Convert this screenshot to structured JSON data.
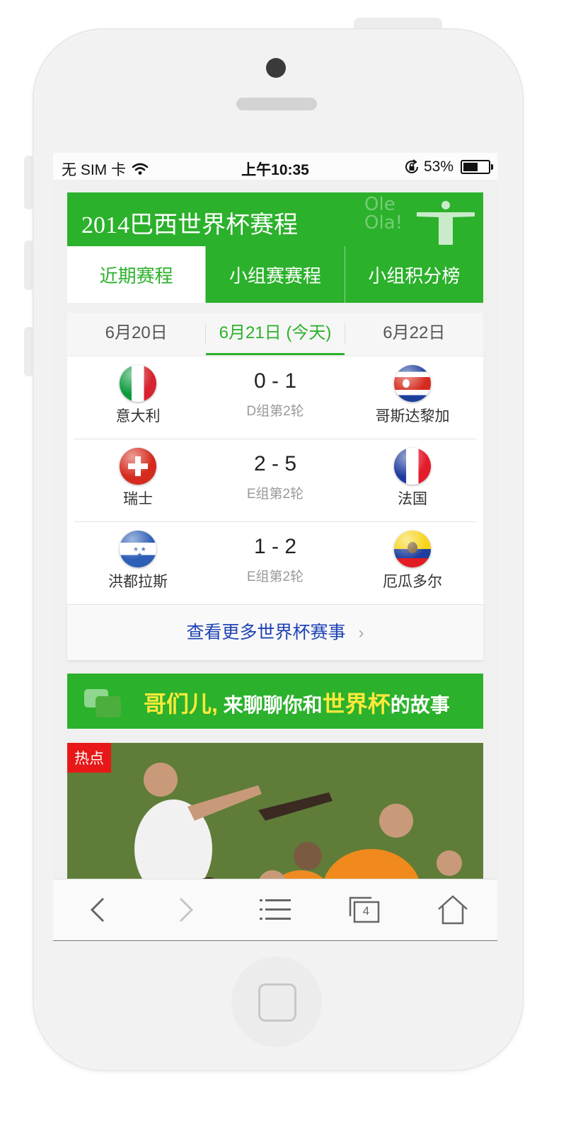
{
  "status_bar": {
    "carrier": "无 SIM 卡",
    "time": "上午10:35",
    "battery": "53%",
    "battery_level": 0.53
  },
  "header": {
    "title": "2014巴西世界杯赛程",
    "deco_text_1": "Ole",
    "deco_text_2": "Ola!"
  },
  "tabs": [
    {
      "label": "近期赛程",
      "active": true
    },
    {
      "label": "小组赛赛程",
      "active": false
    },
    {
      "label": "小组积分榜",
      "active": false
    }
  ],
  "dates": [
    {
      "label": "6月20日",
      "active": false
    },
    {
      "label": "6月21日 (今天)",
      "active": true
    },
    {
      "label": "6月22日",
      "active": false
    }
  ],
  "matches": [
    {
      "home": "意大利",
      "away": "哥斯达黎加",
      "score": "0 - 1",
      "round": "D组第2轮"
    },
    {
      "home": "瑞士",
      "away": "法国",
      "score": "2 - 5",
      "round": "E组第2轮"
    },
    {
      "home": "洪都拉斯",
      "away": "厄瓜多尔",
      "score": "1 - 2",
      "round": "E组第2轮"
    }
  ],
  "more_link": "查看更多世界杯赛事",
  "banner": {
    "part1": "哥们儿,",
    "part2": " 来聊聊你和",
    "part3": "世界杯",
    "part4": "的故事"
  },
  "photo_badge": "热点",
  "toolbar": {
    "tabs_count": "4",
    "icons": [
      "back-icon",
      "forward-icon",
      "menu-icon",
      "tabs-icon",
      "home-icon"
    ]
  },
  "colors": {
    "brand_green": "#2bb12b",
    "link_blue": "#1f43b5",
    "hot_red": "#e81818"
  }
}
